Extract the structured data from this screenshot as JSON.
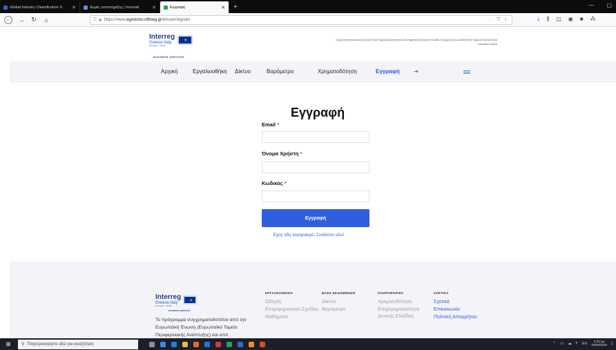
{
  "browser": {
    "tabs": [
      {
        "label": "Global Industry Classification S",
        "active": false
      },
      {
        "label": "Δομές υποστήριξης | Innovati",
        "active": false
      },
      {
        "label": "Εγγραφή",
        "active": true
      }
    ],
    "url_scheme": "https://www.",
    "url_host": "egovinno.rdfnwg.gr",
    "url_path": "/el/user/register",
    "url_right": "··· ⛉ ☆"
  },
  "site": {
    "logo_interreg": "Interreg",
    "logo_country": "Greece-Italy",
    "logo_small": "ΕΛΛΑΔΑ · ΙΤΑΛΙΑ",
    "logo_business": "BUSINESS SERVICES",
    "tagline": "E-government services and tools from regional governments and regional development bodies to support and coordinate the regional research and innovation capital",
    "menu": [
      {
        "label": "Αρχική"
      },
      {
        "label": "Εργαλειοθήκη"
      },
      {
        "label": "Δίκτυο"
      },
      {
        "label": "Βαρόμετρο"
      },
      {
        "label": "Χρηματοδότηση"
      },
      {
        "label": "Εγγραφή",
        "active": true
      }
    ]
  },
  "form": {
    "title": "Εγγραφή",
    "email_label": "Email",
    "username_label": "Όνομα Χρήστη",
    "password_label": "Κωδικός",
    "required_mark": "*",
    "email_value": "",
    "username_value": "",
    "password_value": "",
    "submit_label": "Εγγραφή",
    "login_link": "Έχεις ήδη λογαριασμό; Συνδέσου εδώ!"
  },
  "footer": {
    "description": "Το πρόγραμμα συγχρηματοδοτείται από την Ευρωπαϊκή Ένωση (Ευρωπαϊκό Ταμείο Περιφερειακής Ανάπτυξης) και από",
    "columns": [
      {
        "heading": "ΕΡΓΑΛΕΙΟΘΗΚΗ",
        "links": [
          "Οδηγός",
          "Επιχειρηματικού Σχεδίου",
          "Μαθήματα"
        ]
      },
      {
        "heading": "ΒΑΣΗ ΔΕΔΟΜΕΝΩΝ",
        "links": [
          "Δίκτυο",
          "Βαρόμετρο"
        ]
      },
      {
        "heading": "ΠΛΗΡΟΦΟΡΙΕΣ",
        "links": [
          "Χρηματοδότηση",
          "Επιχειρηματικότητα Δυτικής Ελλάδας"
        ]
      },
      {
        "heading": "ΣΧΕΤΙΚΑ",
        "links": [
          "Σχετικά",
          "Επικοινωνία",
          "Πολιτική Απορρήτου"
        ]
      }
    ]
  },
  "taskbar": {
    "search_placeholder": "Πληκτρολογήστε εδώ για αναζήτηση",
    "lang": "ΕΛ",
    "time": "5:32 μμ",
    "date": "03/06/2020"
  },
  "colors": {
    "accent": "#2f5ee0",
    "required": "#d9322a",
    "footer_bg": "#f4f4f8"
  }
}
